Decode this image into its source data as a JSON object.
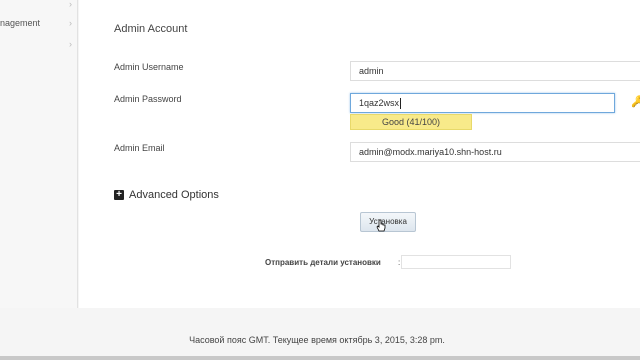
{
  "sidebar": {
    "items": [
      {
        "label": "nagement"
      },
      {
        "label": ""
      }
    ],
    "chevron": "›"
  },
  "admin": {
    "section_title": "Admin Account",
    "username_label": "Admin Username",
    "username_value": "admin",
    "password_label": "Admin Password",
    "password_value": "1qaz2wsx",
    "strength_text": "Good (41/100)",
    "strength_score": 41,
    "email_label": "Admin Email",
    "email_value": "admin@modx.mariya10.shn-host.ru"
  },
  "advanced": {
    "label": "Advanced Options",
    "icon": "plus-square-icon"
  },
  "install_button": "Установка",
  "send_details": {
    "label": "Отправить детали установки",
    "colon": ":",
    "value": ""
  },
  "footer": {
    "text": "Часовой пояс GMT. Текущее время октябрь 3, 2015, 3:28 pm."
  },
  "colors": {
    "strength_bg": "#f8ea8a",
    "focus_border": "#6fa8dc",
    "button_bg": "#dde6ee"
  }
}
